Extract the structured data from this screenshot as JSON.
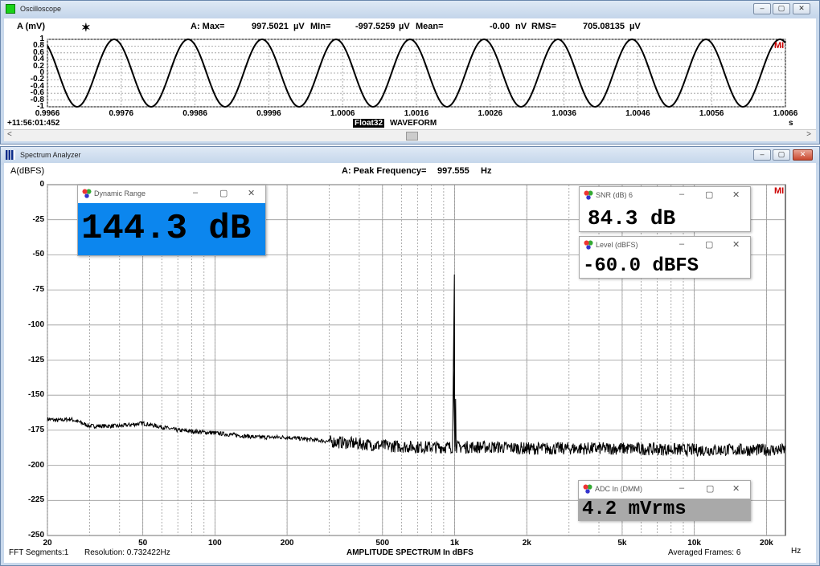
{
  "oscilloscope": {
    "title": "Oscilloscope",
    "channel_label": "A (mV)",
    "max_label": "A: Max=",
    "max_value": "997.5021",
    "max_unit": "µV",
    "min_label": "MIn=",
    "min_value": "-997.5259",
    "min_unit": "µV",
    "mean_label": "Mean=",
    "mean_value": "-0.00",
    "mean_unit": "nV",
    "rms_label": "RMS=",
    "rms_value": "705.08135",
    "rms_unit": "µV",
    "y_ticks": [
      "1",
      "0.8",
      "0.6",
      "0.4",
      "0.2",
      "0",
      "-0.2",
      "-0.4",
      "-0.6",
      "-0.8",
      "-1"
    ],
    "x_ticks": [
      "0.9966",
      "0.9976",
      "0.9986",
      "0.9996",
      "1.0006",
      "1.0016",
      "1.0026",
      "1.0036",
      "1.0046",
      "1.0056",
      "1.0066"
    ],
    "x_unit": "s",
    "timestamp": "+11:56:01:452",
    "format_badge": "Float32",
    "plot_title": "WAVEFORM",
    "marker": "MI",
    "cursor_glyph": "✶"
  },
  "spectrum": {
    "title": "Spectrum Analyzer",
    "channel_label": "A(dBFS)",
    "peak_label": "A: Peak Frequency=",
    "peak_value": "997.555",
    "peak_unit": "Hz",
    "y_ticks": [
      "0",
      "-25",
      "-50",
      "-75",
      "-100",
      "-125",
      "-150",
      "-175",
      "-200",
      "-225",
      "-250"
    ],
    "x_ticks": [
      "20",
      "50",
      "100",
      "200",
      "500",
      "1k",
      "2k",
      "5k",
      "10k",
      "20k"
    ],
    "x_unit": "Hz",
    "fft_segments": "FFT Segments:1",
    "resolution": "Resolution: 0.732422Hz",
    "plot_title": "AMPLITUDE SPECTRUM In dBFS",
    "averaged": "Averaged Frames: 6",
    "marker": "MI"
  },
  "meters": {
    "dynamic_range": {
      "title": "Dynamic Range",
      "value": "144.3 dB"
    },
    "snr": {
      "title": "SNR (dB) 6",
      "value": "84.3 dB"
    },
    "level": {
      "title": "Level (dBFS)",
      "value": "-60.0 dBFS"
    },
    "adc": {
      "title": "ADC In (DMM)",
      "value": "4.2 mVrms"
    }
  },
  "window_controls": {
    "minimize": "–",
    "maximize": "▢",
    "close": "✕"
  },
  "chart_data": [
    {
      "type": "line",
      "title": "WAVEFORM",
      "xlabel": "s",
      "ylabel": "A (mV)",
      "xlim": [
        0.9966,
        1.0066
      ],
      "ylim": [
        -1,
        1
      ],
      "grid": true,
      "series": [
        {
          "frequency_hz": 997.555,
          "amplitude_mv": 1.0,
          "cycles_shown": 9.97
        }
      ]
    },
    {
      "type": "line",
      "title": "AMPLITUDE SPECTRUM In dBFS",
      "xlabel": "Hz",
      "ylabel": "A(dBFS)",
      "x_scale": "log",
      "xlim": [
        20,
        24000
      ],
      "ylim": [
        -250,
        0
      ],
      "grid": true,
      "series": [
        {
          "points": [
            [
              20,
              -167
            ],
            [
              22,
              -168
            ],
            [
              25,
              -167
            ],
            [
              30,
              -172
            ],
            [
              40,
              -172
            ],
            [
              50,
              -170
            ],
            [
              70,
              -175
            ],
            [
              100,
              -177
            ],
            [
              150,
              -180
            ],
            [
              200,
              -180
            ],
            [
              300,
              -183
            ],
            [
              500,
              -186
            ],
            [
              700,
              -187
            ],
            [
              980,
              -187
            ],
            [
              997.555,
              -64
            ],
            [
              1015,
              -187
            ],
            [
              1500,
              -187
            ],
            [
              2000,
              -188
            ],
            [
              3000,
              -188
            ],
            [
              5000,
              -188
            ],
            [
              10000,
              -189
            ],
            [
              24000,
              -189
            ]
          ]
        }
      ]
    }
  ]
}
